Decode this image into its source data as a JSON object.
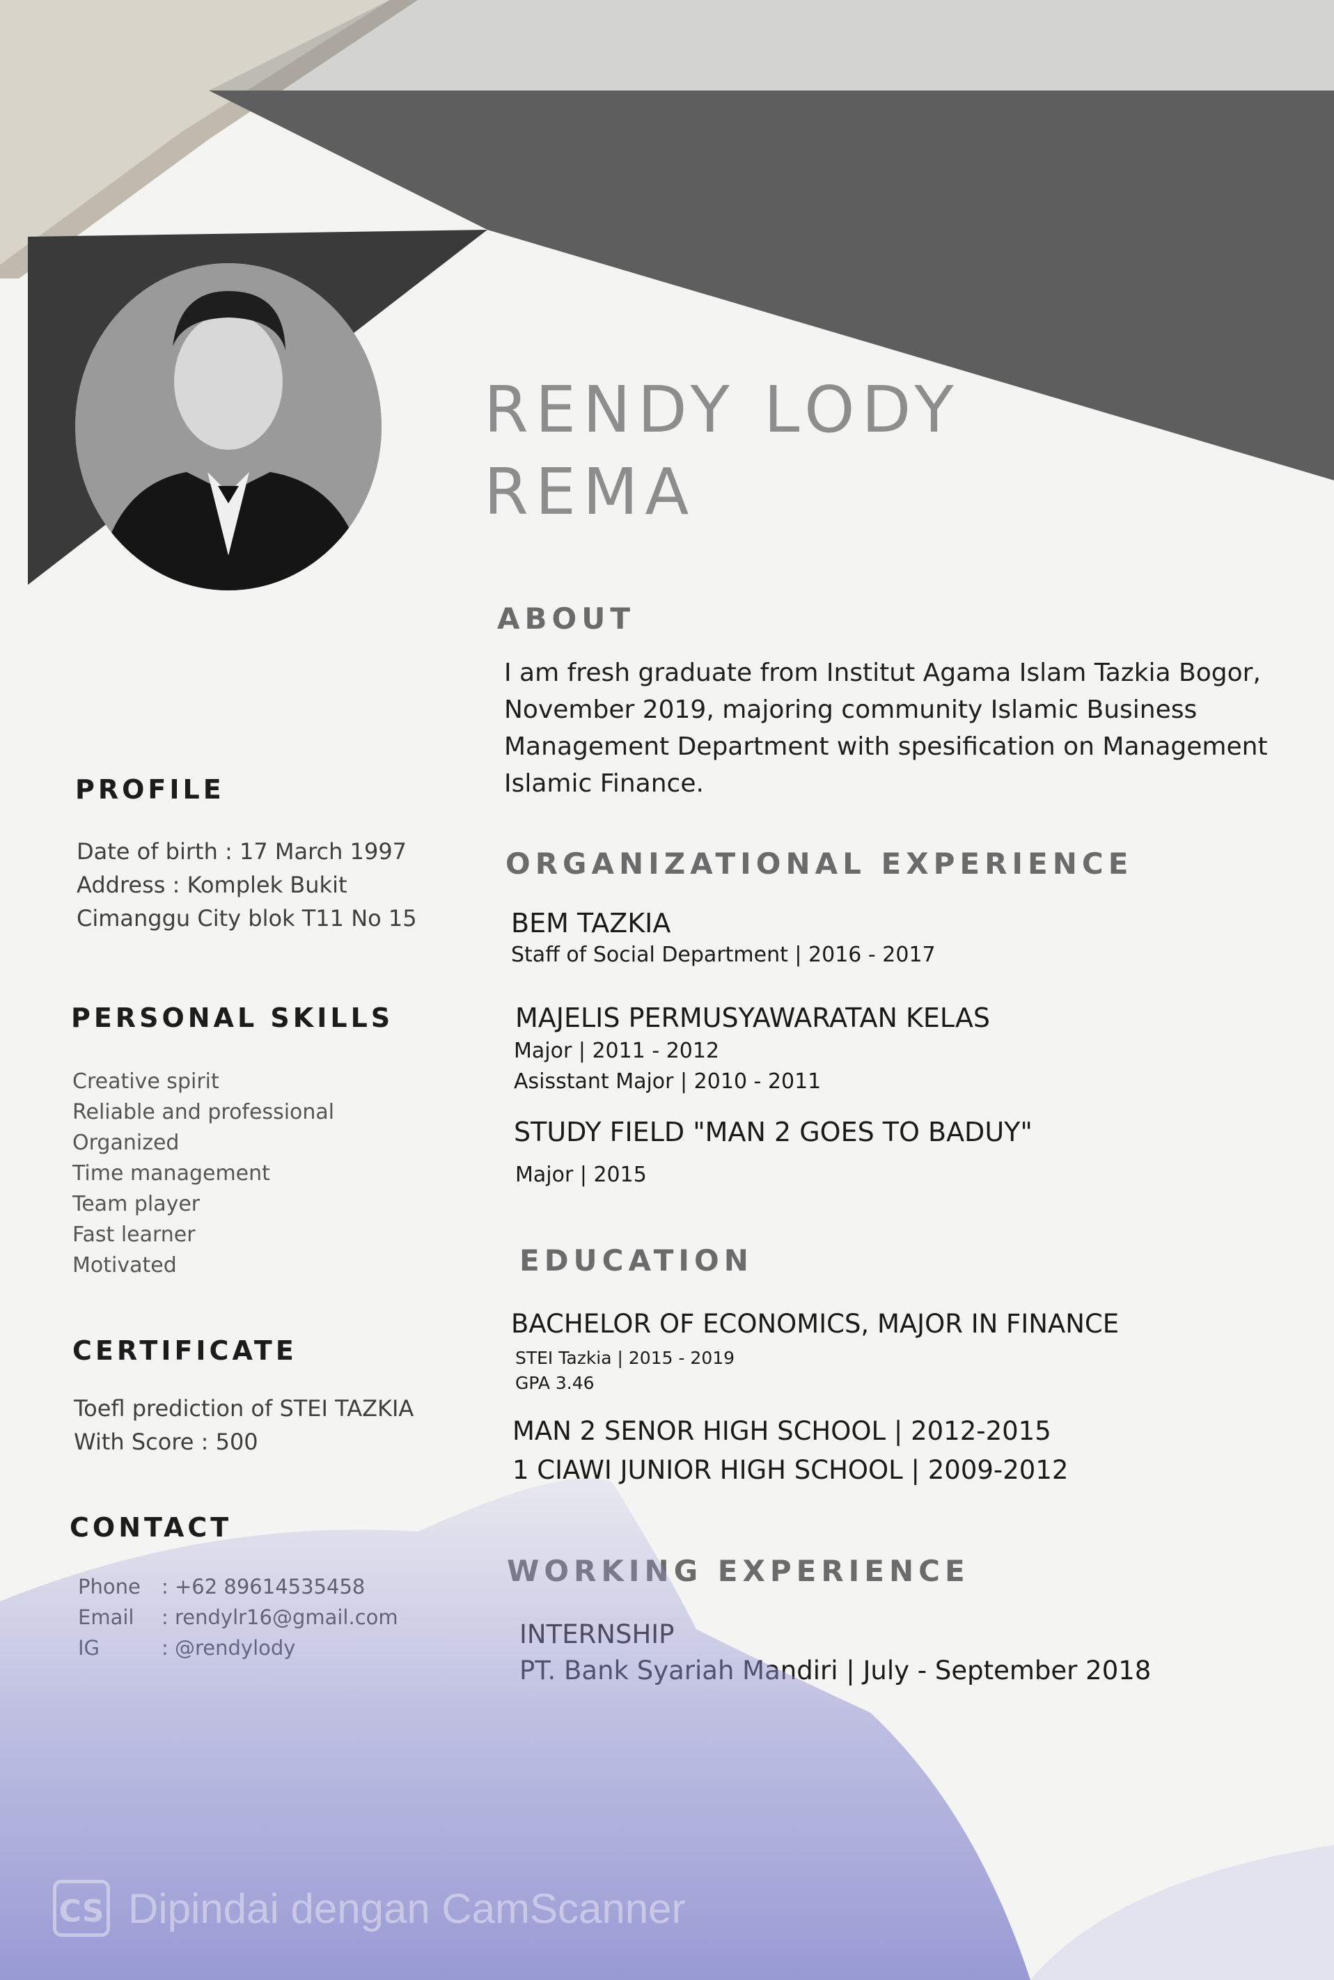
{
  "name": {
    "line1": "RENDY LODY",
    "line2": "REMA"
  },
  "left": {
    "profile": {
      "heading": "PROFILE",
      "lines": [
        "Date of birth : 17 March 1997",
        "Address        : Komplek Bukit",
        "Cimanggu City blok T11 No 15"
      ]
    },
    "skills": {
      "heading": "PERSONAL SKILLS",
      "items": [
        "Creative spirit",
        "Reliable and professional",
        "Organized",
        "Time management",
        "Team player",
        "Fast learner",
        "Motivated"
      ]
    },
    "certificate": {
      "heading": "CERTIFICATE",
      "lines": [
        "Toefl prediction of STEI TAZKIA",
        "With Score : 500"
      ]
    },
    "contact": {
      "heading": "CONTACT",
      "phone_label": "Phone",
      "phone": ": +62 89614535458",
      "email_label": "Email",
      "email": ": rendylr16@gmail.com",
      "ig_label": "IG",
      "ig": ": @rendylody"
    }
  },
  "about": {
    "heading": "ABOUT",
    "lines": [
      "I am fresh graduate from Institut Agama Islam Tazkia Bogor,",
      "November 2019, majoring community Islamic Business",
      "Management Department with spesification on Management",
      "Islamic Finance."
    ]
  },
  "org": {
    "heading": "ORGANIZATIONAL EXPERIENCE",
    "items": [
      {
        "title": "BEM TAZKIA",
        "lines": [
          "Staff of Social Department | 2016 - 2017"
        ]
      },
      {
        "title": "MAJELIS PERMUSYAWARATAN KELAS",
        "lines": [
          "Major | 2011 -  2012",
          "Asisstant Major | 2010 - 2011"
        ]
      },
      {
        "title": "STUDY FIELD \"MAN 2 GOES TO BADUY\"",
        "lines": [
          "Major | 2015"
        ]
      }
    ]
  },
  "education": {
    "heading": "EDUCATION",
    "degree": "BACHELOR OF ECONOMICS, MAJOR IN FINANCE",
    "school": "STEI Tazkia | 2015 - 2019",
    "gpa": "GPA 3.46",
    "high_school": "MAN 2 SENOR HIGH SCHOOL | 2012-2015",
    "junior_school": "1 CIAWI  JUNIOR  HIGH SCHOOL | 2009-2012"
  },
  "work": {
    "heading": "WORKING EXPERIENCE",
    "title": "INTERNSHIP",
    "detail": "PT. Bank Syariah Mandiri  | July - September 2018"
  },
  "watermark": {
    "logo": "CS",
    "text": "Dipindai dengan CamScanner"
  }
}
